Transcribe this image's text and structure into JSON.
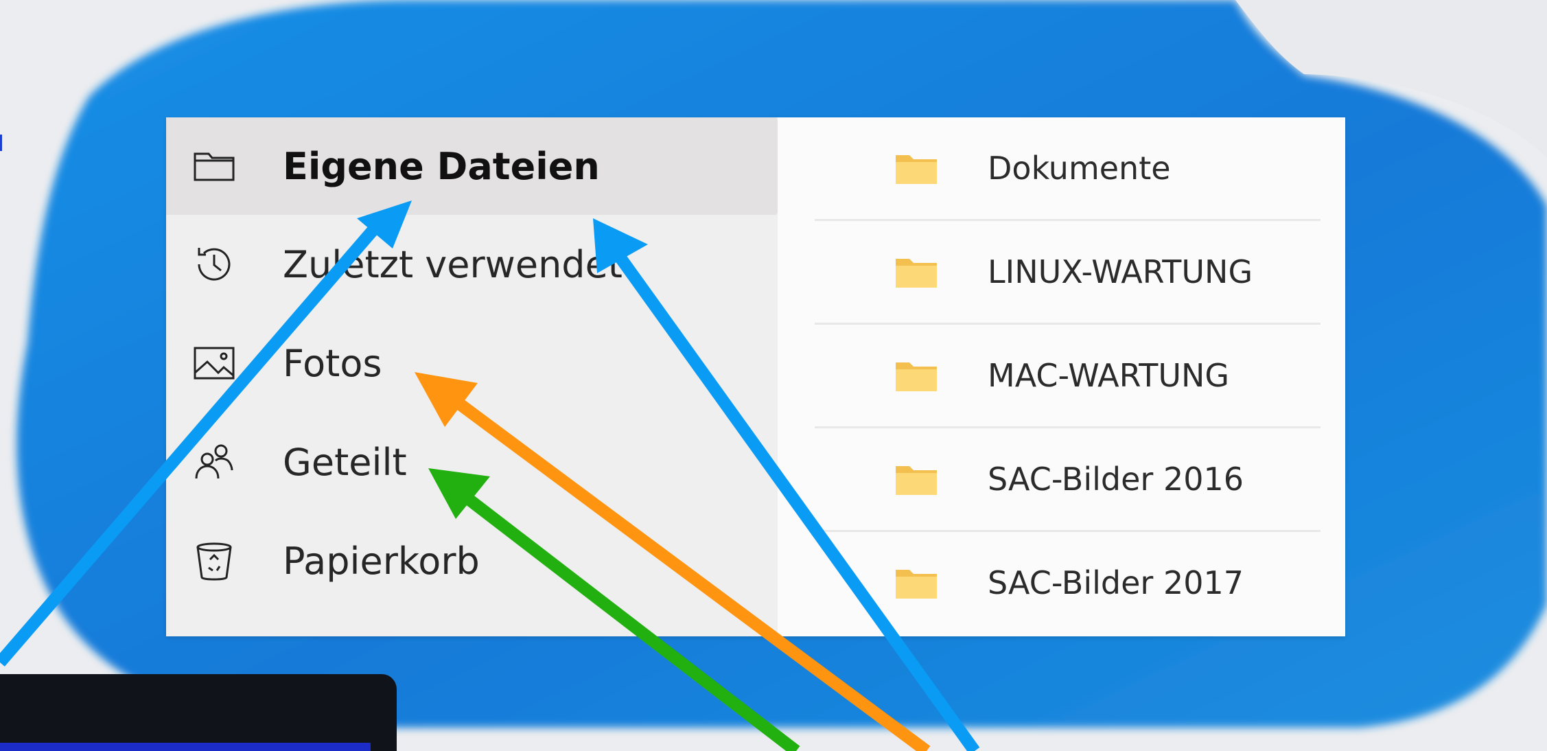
{
  "sidebar": {
    "items": [
      {
        "label": "Eigene Dateien",
        "icon": "folder-outline-icon",
        "active": true
      },
      {
        "label": "Zuletzt verwendet",
        "icon": "history-icon",
        "active": false
      },
      {
        "label": "Fotos",
        "icon": "image-icon",
        "active": false
      },
      {
        "label": "Geteilt",
        "icon": "people-icon",
        "active": false
      },
      {
        "label": "Papierkorb",
        "icon": "recycle-bin-icon",
        "active": false
      }
    ]
  },
  "files": {
    "items": [
      {
        "name": "Dokumente",
        "icon": "folder-icon"
      },
      {
        "name": "LINUX-WARTUNG",
        "icon": "folder-icon"
      },
      {
        "name": "MAC-WARTUNG",
        "icon": "folder-icon"
      },
      {
        "name": "SAC-Bilder 2016",
        "icon": "folder-icon"
      },
      {
        "name": "SAC-Bilder 2017",
        "icon": "folder-icon"
      }
    ]
  },
  "colors": {
    "cloud": "#1a86de",
    "arrow_blue": "#0a9cf5",
    "arrow_orange": "#ff9410",
    "arrow_green": "#22b010",
    "folder_yellow": "#f8d26b"
  }
}
